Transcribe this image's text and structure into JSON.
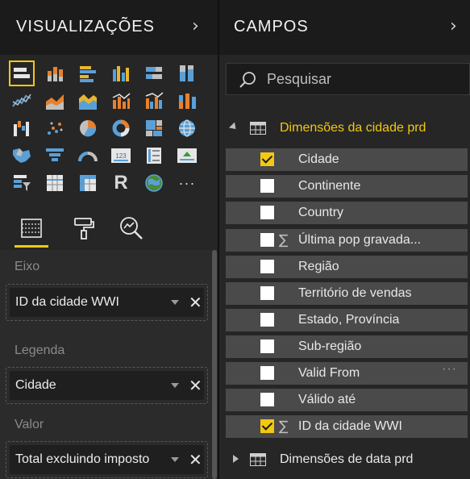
{
  "visualizations": {
    "title": "VISUALIZAÇÕES",
    "icons": [
      "stacked-bar-icon",
      "stacked-column-icon",
      "clustered-bar-icon",
      "clustered-column-icon",
      "stacked-bar-100-icon",
      "stacked-column-100-icon",
      "line-chart-icon",
      "area-chart-icon",
      "stacked-area-icon",
      "line-column-icon",
      "line-clustered-column-icon",
      "ribbon-chart-icon",
      "waterfall-icon",
      "scatter-icon",
      "pie-icon",
      "donut-icon",
      "treemap-icon",
      "map-icon",
      "filled-map-icon",
      "funnel-icon",
      "gauge-icon",
      "card-icon",
      "multi-row-card-icon",
      "kpi-icon",
      "slicer-icon",
      "table-icon",
      "matrix-icon",
      "r-visual-icon",
      "globe-icon",
      "more-visuals-icon"
    ],
    "r_label": "R",
    "more_label": "···",
    "tabs": [
      "fields-tab",
      "format-tab",
      "analytics-tab"
    ]
  },
  "wells": [
    {
      "label": "Eixo",
      "value": "ID da cidade WWI"
    },
    {
      "label": "Legenda",
      "value": "Cidade"
    },
    {
      "label": "Valor",
      "value": "Total excluindo imposto"
    }
  ],
  "fields": {
    "title": "CAMPOS",
    "search_placeholder": "Pesquisar",
    "table1": {
      "name": "Dimensões da cidade prd",
      "rows": [
        {
          "name": "Cidade",
          "checked": true,
          "sigma": false
        },
        {
          "name": "Continente",
          "checked": false,
          "sigma": false
        },
        {
          "name": "Country",
          "checked": false,
          "sigma": false
        },
        {
          "name": "Última pop gravada...",
          "checked": false,
          "sigma": true
        },
        {
          "name": "Região",
          "checked": false,
          "sigma": false
        },
        {
          "name": "Território de vendas",
          "checked": false,
          "sigma": false
        },
        {
          "name": "Estado, Província",
          "checked": false,
          "sigma": false
        },
        {
          "name": "Sub-região",
          "checked": false,
          "sigma": false
        },
        {
          "name": "Valid From",
          "checked": false,
          "sigma": false,
          "more": "···"
        },
        {
          "name": "Válido até",
          "checked": false,
          "sigma": false
        },
        {
          "name": "ID da cidade WWI",
          "checked": true,
          "sigma": true
        }
      ]
    },
    "table2": {
      "name": "Dimensões de data prd"
    }
  },
  "colors": {
    "accent": "#f2c811",
    "pane": "#262626",
    "header": "#1b1b1b",
    "row": "#4a4a4a"
  }
}
